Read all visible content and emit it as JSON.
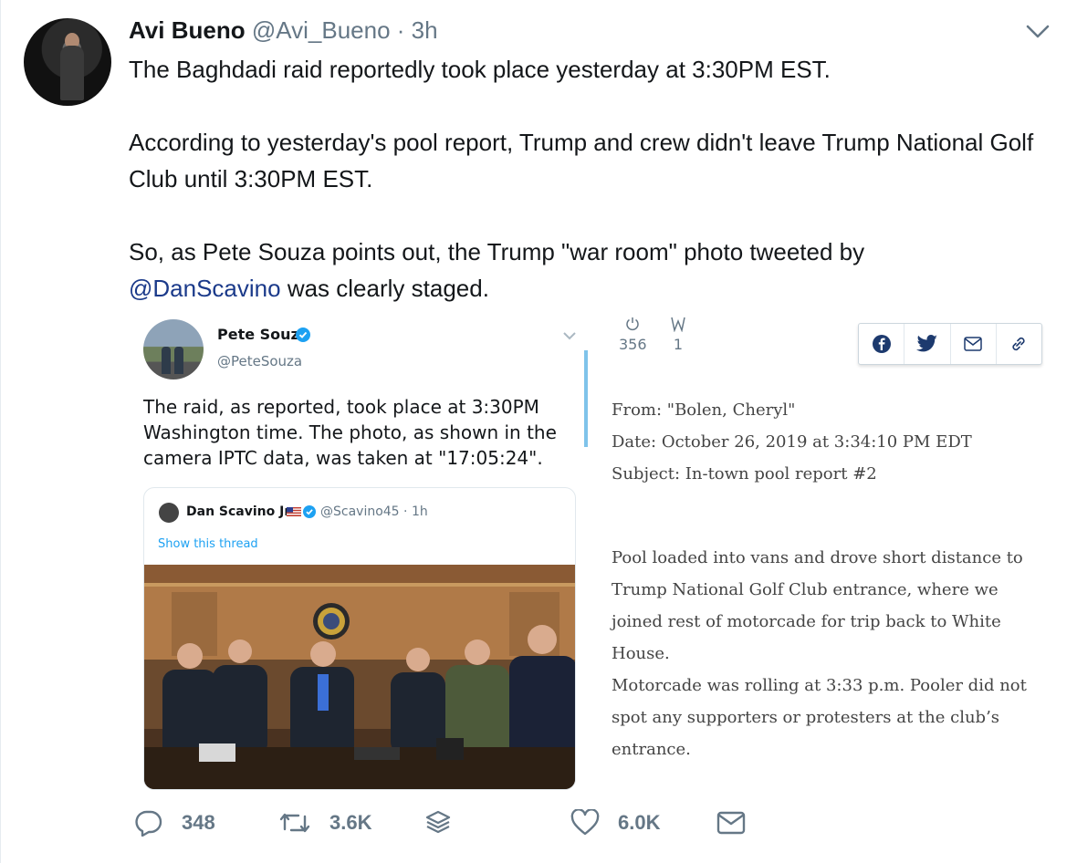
{
  "tweet": {
    "author_name": "Avi Bueno",
    "author_handle": "@Avi_Bueno",
    "separator": "·",
    "time": "3h",
    "paragraph1": "The Baghdadi raid reportedly took place yesterday at 3:30PM EST.",
    "paragraph2": "According to yesterday's pool report, Trump and crew didn't leave Trump National Golf Club until 3:30PM EST.",
    "paragraph3_before": "So, as Pete Souza points out, the Trump \"war room\" photo tweeted by",
    "paragraph3_mention": "@DanScavino",
    "paragraph3_after": " was clearly staged."
  },
  "embed": {
    "author_name": "Pete Souza",
    "author_handle": "@PeteSouza",
    "text": "The raid, as reported, took place at 3:30PM Washington time. The photo, as shown in the camera IPTC data, was taken at \"17:05:24\".",
    "quoted": {
      "author_name": "Dan Scavino Jr.",
      "author_handle": "@Scavino45 · 1h",
      "show_thread": "Show this thread"
    },
    "stats": {
      "count1": "356",
      "count2": "1"
    },
    "share_icons": [
      "facebook-icon",
      "twitter-icon",
      "email-icon",
      "link-icon"
    ],
    "email": {
      "from": "From: \"Bolen, Cheryl\"",
      "date": "Date: October 26, 2019 at 3:34:10 PM EDT",
      "subject": "Subject: In-town pool report #2",
      "body1": "Pool loaded into vans and drove short distance to Trump National Golf Club entrance, where we joined rest of motorcade for trip back to White House.",
      "body2": "Motorcade was rolling at 3:33 p.m. Pooler did not spot any supporters or protesters at the club’s entrance."
    }
  },
  "actions": {
    "reply_count": "348",
    "retweet_count": "3.6K",
    "like_count": "6.0K"
  },
  "colors": {
    "accent": "#1da1f2",
    "mention": "#1b3a8a",
    "muted": "#657786"
  }
}
